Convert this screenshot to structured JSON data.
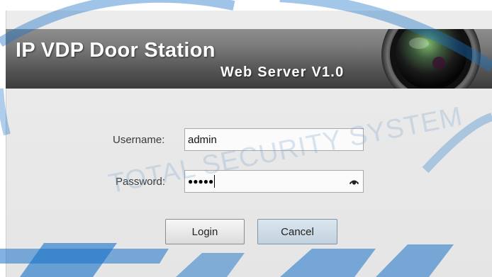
{
  "banner": {
    "title": "IP VDP Door Station",
    "subtitle": "Web Server V1.0"
  },
  "login_form": {
    "username_label": "Username:",
    "username_value": "admin",
    "password_label": "Password:",
    "password_masked": "●●●●●",
    "show_password_icon": "eye-icon"
  },
  "buttons": {
    "login": "Login",
    "cancel": "Cancel"
  },
  "watermark": {
    "text": "TOTAL SECURITY SYSTEM"
  },
  "colors": {
    "watermark_blue": "#1a73c8",
    "banner_dark": "#3c3c3c",
    "panel_bg": "#e8e8e8"
  }
}
